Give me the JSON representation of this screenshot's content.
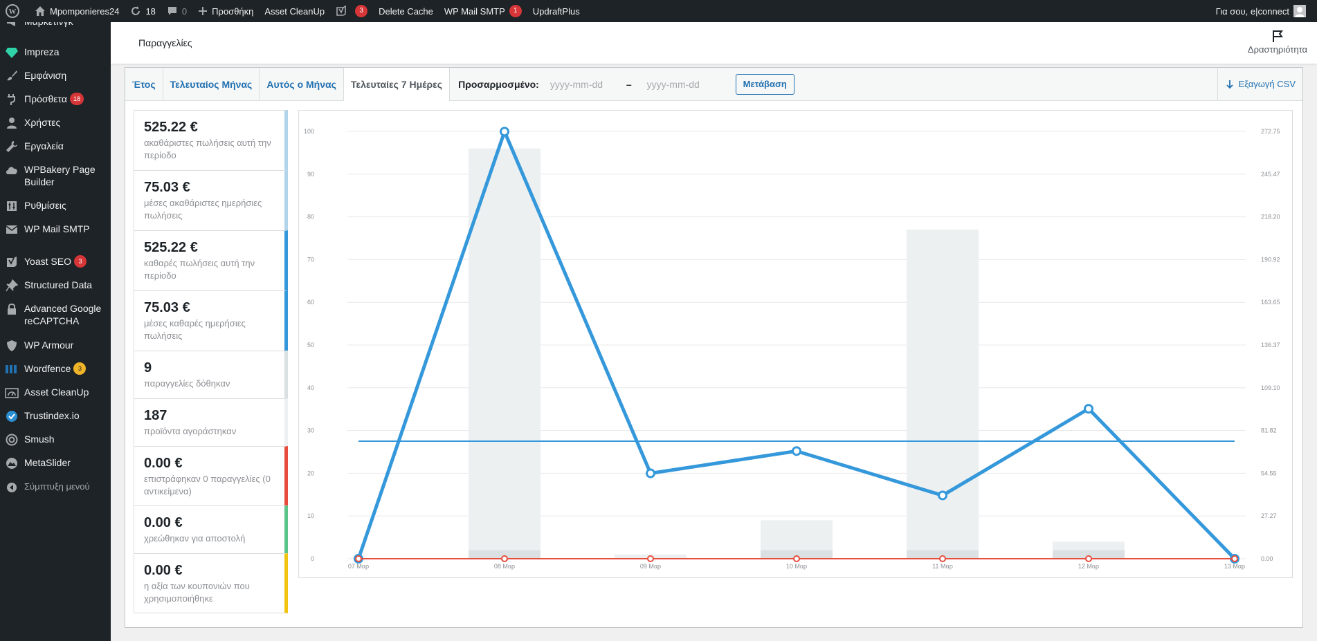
{
  "adminbar": {
    "site_name": "Mpomponieres24",
    "updates_count": "18",
    "comments_count": "0",
    "new_label": "Προσθήκη",
    "asset_cleanup": "Asset CleanUp",
    "yoast_count": "3",
    "delete_cache": "Delete Cache",
    "wp_mail_smtp": "WP Mail SMTP",
    "wp_mail_smtp_count": "1",
    "updraftplus": "UpdraftPlus",
    "greeting": "Για σου, e|connect"
  },
  "sidebar": {
    "items": [
      {
        "label": "Μάρκετινγκ",
        "icon": "marketing-icon"
      },
      {
        "label": "Impreza",
        "icon": "diamond-icon"
      },
      {
        "label": "Εμφάνιση",
        "icon": "paintbrush-icon"
      },
      {
        "label": "Πρόσθετα",
        "icon": "plugin-icon",
        "badge": "18"
      },
      {
        "label": "Χρήστες",
        "icon": "users-icon"
      },
      {
        "label": "Εργαλεία",
        "icon": "wrench-icon"
      },
      {
        "label": "WPBakery Page Builder",
        "icon": "cloud-icon"
      },
      {
        "label": "Ρυθμίσεις",
        "icon": "settings-icon"
      },
      {
        "label": "WP Mail SMTP",
        "icon": "mail-icon"
      },
      {
        "label": "Yoast SEO",
        "icon": "yoast-icon",
        "badge": "3"
      },
      {
        "label": "Structured Data",
        "icon": "pin-icon"
      },
      {
        "label": "Advanced Google reCAPTCHA",
        "icon": "lock-icon"
      },
      {
        "label": "WP Armour",
        "icon": "shield-icon"
      },
      {
        "label": "Wordfence",
        "icon": "wordfence-icon",
        "badge": "3"
      },
      {
        "label": "Asset CleanUp",
        "icon": "gauge-icon"
      },
      {
        "label": "Trustindex.io",
        "icon": "check-badge-icon"
      },
      {
        "label": "Smush",
        "icon": "smush-icon"
      },
      {
        "label": "MetaSlider",
        "icon": "mountain-icon"
      },
      {
        "label": "Σύμπτυξη μενού",
        "icon": "collapse-icon"
      }
    ]
  },
  "header": {
    "title": "Παραγγελίες",
    "activity_label": "Δραστηριότητα"
  },
  "tabs": {
    "year": "Έτος",
    "last_month": "Τελευταίος Μήνας",
    "this_month": "Αυτός ο Μήνας",
    "last_7_days": "Τελευταίες 7 Ημέρες",
    "custom_label": "Προσαρμοσμένο:",
    "date_placeholder": "yyyy-mm-dd",
    "date_separator": "–",
    "go_button": "Μετάβαση",
    "export_csv": "Εξαγωγή CSV"
  },
  "legend": [
    {
      "amount": "525.22 €",
      "desc": "ακαθάριστες πωλήσεις αυτή την περίοδο",
      "color": "#b1d4ea"
    },
    {
      "amount": "75.03 €",
      "desc": "μέσες ακαθάριστες ημερήσιες πωλήσεις",
      "color": "#b1d4ea"
    },
    {
      "amount": "525.22 €",
      "desc": "καθαρές πωλήσεις αυτή την περίοδο",
      "color": "#3498db"
    },
    {
      "amount": "75.03 €",
      "desc": "μέσες καθαρές ημερήσιες πωλήσεις",
      "color": "#3498db"
    },
    {
      "amount": "9",
      "desc": "παραγγελίες δόθηκαν",
      "color": "#dbe1e3"
    },
    {
      "amount": "187",
      "desc": "προϊόντα αγοράστηκαν",
      "color": "#ecf0f1"
    },
    {
      "amount": "0.00 €",
      "desc": "επιστράφηκαν 0 παραγγελίες (0 αντικείμενα)",
      "color": "#e74c3c"
    },
    {
      "amount": "0.00 €",
      "desc": "χρεώθηκαν για αποστολή",
      "color": "#5cc488"
    },
    {
      "amount": "0.00 €",
      "desc": "η αξία των κουπονιών που χρησιμοποιήθηκε",
      "color": "#f1c40f"
    }
  ],
  "chart_data": {
    "type": "bar",
    "categories": [
      "07 Μαρ",
      "08 Μαρ",
      "09 Μαρ",
      "10 Μαρ",
      "11 Μαρ",
      "12 Μαρ",
      "13 Μαρ"
    ],
    "ylim_left": [
      0,
      100
    ],
    "yticks_left": [
      "0",
      "10",
      "20",
      "30",
      "40",
      "50",
      "60",
      "70",
      "80",
      "90",
      "100"
    ],
    "ylim_right": [
      0,
      272.75
    ],
    "yticks_right": [
      "0.00",
      "27.27",
      "54.55",
      "81.82",
      "109.10",
      "136.37",
      "163.65",
      "190.92",
      "218.20",
      "245.47",
      "272.75"
    ],
    "series": [
      {
        "kind": "bar",
        "axis": "left",
        "color": "#ecf0f1",
        "values": [
          0,
          96,
          1,
          9,
          77,
          4,
          0
        ]
      },
      {
        "kind": "bar",
        "axis": "left",
        "color": "#dbe1e3",
        "values": [
          0,
          2,
          0,
          2,
          2,
          2,
          0
        ]
      },
      {
        "kind": "line",
        "axis": "right",
        "color": "#3498db",
        "values": [
          0,
          272.6,
          54.5,
          68.7,
          40.4,
          95.7,
          0
        ]
      },
      {
        "kind": "line",
        "axis": "right",
        "color": "#3498db",
        "values": [
          75.03,
          75.03,
          75.03,
          75.03,
          75.03,
          75.03,
          75.03
        ]
      },
      {
        "kind": "line",
        "axis": "right",
        "color": "#e74c3c",
        "values": [
          0,
          0,
          0,
          0,
          0,
          0,
          0
        ]
      }
    ],
    "grid": true
  }
}
